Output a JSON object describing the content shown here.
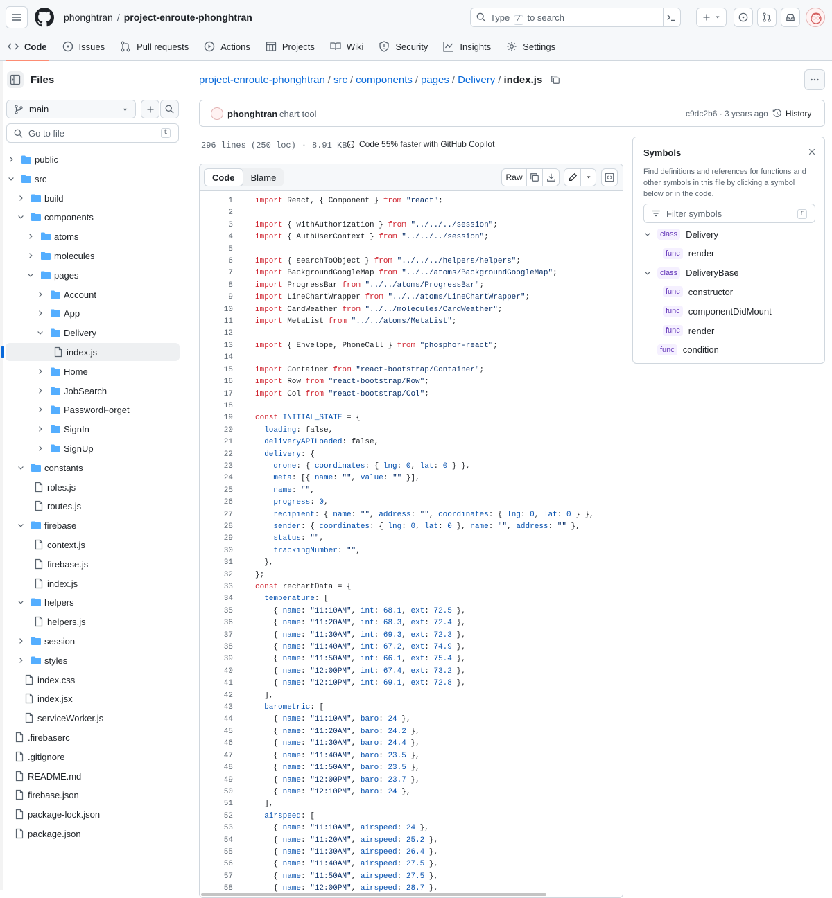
{
  "repo": {
    "owner": "phonghtran",
    "name": "project-enroute-phonghtran"
  },
  "search": {
    "placeholder_pre": "Type",
    "placeholder_key": "/",
    "placeholder_post": "to search"
  },
  "tabs": [
    {
      "label": "Code"
    },
    {
      "label": "Issues"
    },
    {
      "label": "Pull requests"
    },
    {
      "label": "Actions"
    },
    {
      "label": "Projects"
    },
    {
      "label": "Wiki"
    },
    {
      "label": "Security"
    },
    {
      "label": "Insights"
    },
    {
      "label": "Settings"
    }
  ],
  "files": {
    "title": "Files",
    "branch": "main",
    "goto": "Go to file",
    "goto_key": "t"
  },
  "tree": [
    {
      "label": "public",
      "type": "dir",
      "depth": 0,
      "open": false
    },
    {
      "label": "src",
      "type": "dir",
      "depth": 0,
      "open": true
    },
    {
      "label": "build",
      "type": "dir",
      "depth": 1,
      "open": false
    },
    {
      "label": "components",
      "type": "dir",
      "depth": 1,
      "open": true
    },
    {
      "label": "atoms",
      "type": "dir",
      "depth": 2,
      "open": false
    },
    {
      "label": "molecules",
      "type": "dir",
      "depth": 2,
      "open": false
    },
    {
      "label": "pages",
      "type": "dir",
      "depth": 2,
      "open": true
    },
    {
      "label": "Account",
      "type": "dir",
      "depth": 3,
      "open": false
    },
    {
      "label": "App",
      "type": "dir",
      "depth": 3,
      "open": false
    },
    {
      "label": "Delivery",
      "type": "dir",
      "depth": 3,
      "open": true
    },
    {
      "label": "index.js",
      "type": "file",
      "depth": 4,
      "selected": true
    },
    {
      "label": "Home",
      "type": "dir",
      "depth": 3,
      "open": false
    },
    {
      "label": "JobSearch",
      "type": "dir",
      "depth": 3,
      "open": false
    },
    {
      "label": "PasswordForget",
      "type": "dir",
      "depth": 3,
      "open": false
    },
    {
      "label": "SignIn",
      "type": "dir",
      "depth": 3,
      "open": false
    },
    {
      "label": "SignUp",
      "type": "dir",
      "depth": 3,
      "open": false
    },
    {
      "label": "constants",
      "type": "dir",
      "depth": 1,
      "open": true
    },
    {
      "label": "roles.js",
      "type": "file",
      "depth": 2
    },
    {
      "label": "routes.js",
      "type": "file",
      "depth": 2
    },
    {
      "label": "firebase",
      "type": "dir",
      "depth": 1,
      "open": true
    },
    {
      "label": "context.js",
      "type": "file",
      "depth": 2
    },
    {
      "label": "firebase.js",
      "type": "file",
      "depth": 2
    },
    {
      "label": "index.js",
      "type": "file",
      "depth": 2
    },
    {
      "label": "helpers",
      "type": "dir",
      "depth": 1,
      "open": true
    },
    {
      "label": "helpers.js",
      "type": "file",
      "depth": 2
    },
    {
      "label": "session",
      "type": "dir",
      "depth": 1,
      "open": false
    },
    {
      "label": "styles",
      "type": "dir",
      "depth": 1,
      "open": false
    },
    {
      "label": "index.css",
      "type": "file",
      "depth": 1
    },
    {
      "label": "index.jsx",
      "type": "file",
      "depth": 1
    },
    {
      "label": "serviceWorker.js",
      "type": "file",
      "depth": 1
    },
    {
      "label": ".firebaserc",
      "type": "file",
      "depth": 0
    },
    {
      "label": ".gitignore",
      "type": "file",
      "depth": 0
    },
    {
      "label": "README.md",
      "type": "file",
      "depth": 0
    },
    {
      "label": "firebase.json",
      "type": "file",
      "depth": 0
    },
    {
      "label": "package-lock.json",
      "type": "file",
      "depth": 0
    },
    {
      "label": "package.json",
      "type": "file",
      "depth": 0
    }
  ],
  "breadcrumb": [
    "project-enroute-phonghtran",
    "src",
    "components",
    "pages",
    "Delivery"
  ],
  "current_file": "index.js",
  "commit": {
    "author": "phonghtran",
    "message": "chart tool",
    "sha": "c9dc2b6 · 3 years ago",
    "history": "History"
  },
  "file_meta": {
    "lines": "296 lines (250 loc)",
    "dot": "·",
    "size": "8.91 KB",
    "copilot": "Code 55% faster with GitHub Copilot"
  },
  "code_tabs": {
    "code": "Code",
    "blame": "Blame",
    "raw": "Raw"
  },
  "symbols": {
    "title": "Symbols",
    "desc": "Find definitions and references for functions and other symbols in this file by clicking a symbol below or in the code.",
    "filter": "Filter symbols",
    "filter_key": "r",
    "items": [
      {
        "kind": "class",
        "name": "Delivery",
        "indent": 0,
        "chev": true
      },
      {
        "kind": "func",
        "name": "render",
        "indent": 1,
        "chev": false
      },
      {
        "kind": "class",
        "name": "DeliveryBase",
        "indent": 0,
        "chev": true
      },
      {
        "kind": "func",
        "name": "constructor",
        "indent": 1,
        "chev": false
      },
      {
        "kind": "func",
        "name": "componentDidMount",
        "indent": 1,
        "chev": false
      },
      {
        "kind": "func",
        "name": "render",
        "indent": 1,
        "chev": false
      },
      {
        "kind": "func",
        "name": "condition",
        "indent": 0,
        "chev": false,
        "root": true
      }
    ]
  },
  "code": [
    "import React, { Component } from \"react\";",
    "",
    "import { withAuthorization } from \"../../../session\";",
    "import { AuthUserContext } from \"../../../session\";",
    "",
    "import { searchToObject } from \"../../../helpers/helpers\";",
    "import BackgroundGoogleMap from \"../../atoms/BackgroundGoogleMap\";",
    "import ProgressBar from \"../../atoms/ProgressBar\";",
    "import LineChartWrapper from \"../../atoms/LineChartWrapper\";",
    "import CardWeather from \"../../molecules/CardWeather\";",
    "import MetaList from \"../../atoms/MetaList\";",
    "",
    "import { Envelope, PhoneCall } from \"phosphor-react\";",
    "",
    "import Container from \"react-bootstrap/Container\";",
    "import Row from \"react-bootstrap/Row\";",
    "import Col from \"react-bootstrap/Col\";",
    "",
    "const INITIAL_STATE = {",
    "  loading: false,",
    "  deliveryAPILoaded: false,",
    "  delivery: {",
    "    drone: { coordinates: { lng: 0, lat: 0 } },",
    "    meta: [{ name: \"\", value: \"\" }],",
    "    name: \"\",",
    "    progress: 0,",
    "    recipient: { name: \"\", address: \"\", coordinates: { lng: 0, lat: 0 } },",
    "    sender: { coordinates: { lng: 0, lat: 0 }, name: \"\", address: \"\" },",
    "    status: \"\",",
    "    trackingNumber: \"\",",
    "  },",
    "};",
    "const rechartData = {",
    "  temperature: [",
    "    { name: \"11:10AM\", int: 68.1, ext: 72.5 },",
    "    { name: \"11:20AM\", int: 68.3, ext: 72.4 },",
    "    { name: \"11:30AM\", int: 69.3, ext: 72.3 },",
    "    { name: \"11:40AM\", int: 67.2, ext: 74.9 },",
    "    { name: \"11:50AM\", int: 66.1, ext: 75.4 },",
    "    { name: \"12:00PM\", int: 67.4, ext: 73.2 },",
    "    { name: \"12:10PM\", int: 69.1, ext: 72.8 },",
    "  ],",
    "  barometric: [",
    "    { name: \"11:10AM\", baro: 24 },",
    "    { name: \"11:20AM\", baro: 24.2 },",
    "    { name: \"11:30AM\", baro: 24.4 },",
    "    { name: \"11:40AM\", baro: 23.5 },",
    "    { name: \"11:50AM\", baro: 23.5 },",
    "    { name: \"12:00PM\", baro: 23.7 },",
    "    { name: \"12:10PM\", baro: 24 },",
    "  ],",
    "  airspeed: [",
    "    { name: \"11:10AM\", airspeed: 24 },",
    "    { name: \"11:20AM\", airspeed: 25.2 },",
    "    { name: \"11:30AM\", airspeed: 26.4 },",
    "    { name: \"11:40AM\", airspeed: 27.5 },",
    "    { name: \"11:50AM\", airspeed: 27.5 },",
    "    { name: \"12:00PM\", airspeed: 28.7 },"
  ],
  "colors": {
    "accent": "#0969da",
    "tab_underline": "#fd8c73",
    "folder": "#54aeff",
    "keyword": "#cf222e",
    "string": "#0a3069",
    "property": "#0550ae"
  }
}
